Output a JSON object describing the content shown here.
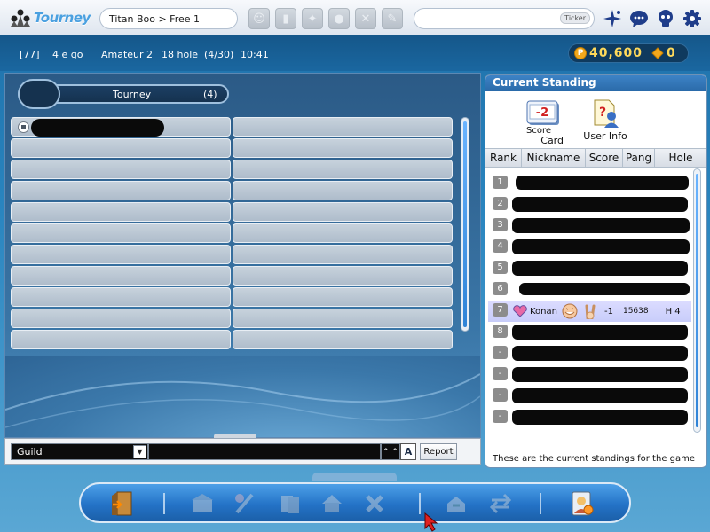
{
  "topbar": {
    "logo_text": "Tourney",
    "room": "Titan Boo > Free 1",
    "ticker_label": "Ticker",
    "tool_icons": [
      "avatar-icon",
      "bag-icon",
      "club-icon",
      "ball-icon",
      "tool-x-icon",
      "card-icon"
    ],
    "right_icons": [
      "sparkle-icon",
      "chat-bubble-icon",
      "skull-icon",
      "gear-icon"
    ]
  },
  "infobar": {
    "room_number": "[77]",
    "players": "4 e go",
    "level": "Amateur 2",
    "holes": "18 hole",
    "progress": "(4/30)",
    "time": "10:41",
    "pang": "40,600",
    "cookies": "0"
  },
  "left_panel": {
    "tab_name": "Tourney",
    "tab_count": "(4)"
  },
  "chat": {
    "channel": "Guild",
    "caret_label": "^ ^",
    "font_label": "A",
    "report_label": "Report"
  },
  "standings": {
    "title": "Current Standing",
    "scorecard_value": "-2",
    "scorecard_label_1": "Score",
    "scorecard_label_2": "Card",
    "userinfo_label": "User Info",
    "columns": [
      "Rank",
      "Nickname",
      "Score",
      "Pang",
      "Hole"
    ],
    "ranks": [
      "1",
      "2",
      "3",
      "4",
      "5",
      "6",
      "7",
      "8",
      "-",
      "-",
      "-",
      "-"
    ],
    "me": {
      "rank": "7",
      "nickname": "Konan",
      "score": "-1",
      "pang": "15638",
      "hole": "H 4"
    },
    "footer": "These are the current standings for the game"
  },
  "colors": {
    "accent": "#2a6aa9",
    "highlight_row": "#c8cdfa",
    "pang_text": "#ffd95a"
  }
}
